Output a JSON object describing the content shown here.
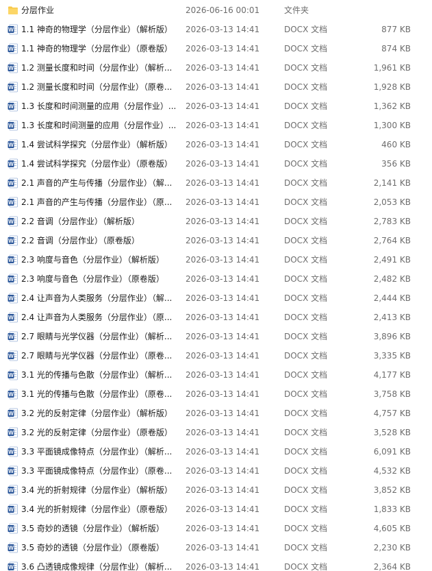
{
  "colors": {
    "word_icon_blue": "#2b579a",
    "folder_yellow": "#f8c94a",
    "secondary_text": "#6d6d6d"
  },
  "rows": [
    {
      "icon": "folder-icon",
      "name": "分层作业",
      "date": "2026-06-16 00:01",
      "type": "文件夹",
      "size": ""
    },
    {
      "icon": "word-doc-icon",
      "name": "1.1 神奇的物理学（分层作业）（解析版）",
      "date": "2026-03-13 14:41",
      "type": "DOCX 文档",
      "size": "877 KB"
    },
    {
      "icon": "word-doc-icon",
      "name": "1.1 神奇的物理学（分层作业）（原卷版）",
      "date": "2026-03-13 14:41",
      "type": "DOCX 文档",
      "size": "874 KB"
    },
    {
      "icon": "word-doc-icon",
      "name": "1.2 测量长度和时间（分层作业）（解析...",
      "date": "2026-03-13 14:41",
      "type": "DOCX 文档",
      "size": "1,961 KB"
    },
    {
      "icon": "word-doc-icon",
      "name": "1.2 测量长度和时间（分层作业）（原卷...",
      "date": "2026-03-13 14:41",
      "type": "DOCX 文档",
      "size": "1,928 KB"
    },
    {
      "icon": "word-doc-icon",
      "name": "1.3 长度和时间测量的应用（分层作业）...",
      "date": "2026-03-13 14:41",
      "type": "DOCX 文档",
      "size": "1,362 KB"
    },
    {
      "icon": "word-doc-icon",
      "name": "1.3 长度和时间测量的应用（分层作业）...",
      "date": "2026-03-13 14:41",
      "type": "DOCX 文档",
      "size": "1,300 KB"
    },
    {
      "icon": "word-doc-icon",
      "name": "1.4 尝试科学探究（分层作业）（解析版）",
      "date": "2026-03-13 14:41",
      "type": "DOCX 文档",
      "size": "460 KB"
    },
    {
      "icon": "word-doc-icon",
      "name": "1.4 尝试科学探究（分层作业）（原卷版）",
      "date": "2026-03-13 14:41",
      "type": "DOCX 文档",
      "size": "356 KB"
    },
    {
      "icon": "word-doc-icon",
      "name": "2.1 声音的产生与传播（分层作业）（解...",
      "date": "2026-03-13 14:41",
      "type": "DOCX 文档",
      "size": "2,141 KB"
    },
    {
      "icon": "word-doc-icon",
      "name": "2.1 声音的产生与传播（分层作业）（原...",
      "date": "2026-03-13 14:41",
      "type": "DOCX 文档",
      "size": "2,053 KB"
    },
    {
      "icon": "word-doc-icon",
      "name": "2.2 音调（分层作业）（解析版）",
      "date": "2026-03-13 14:41",
      "type": "DOCX 文档",
      "size": "2,783 KB"
    },
    {
      "icon": "word-doc-icon",
      "name": "2.2 音调（分层作业）（原卷版）",
      "date": "2026-03-13 14:41",
      "type": "DOCX 文档",
      "size": "2,764 KB"
    },
    {
      "icon": "word-doc-icon",
      "name": "2.3 响度与音色（分层作业）（解析版）",
      "date": "2026-03-13 14:41",
      "type": "DOCX 文档",
      "size": "2,491 KB"
    },
    {
      "icon": "word-doc-icon",
      "name": "2.3 响度与音色（分层作业）（原卷版）",
      "date": "2026-03-13 14:41",
      "type": "DOCX 文档",
      "size": "2,482 KB"
    },
    {
      "icon": "word-doc-icon",
      "name": "2.4 让声音为人类服务（分层作业）（解...",
      "date": "2026-03-13 14:41",
      "type": "DOCX 文档",
      "size": "2,444 KB"
    },
    {
      "icon": "word-doc-icon",
      "name": "2.4 让声音为人类服务（分层作业）（原...",
      "date": "2026-03-13 14:41",
      "type": "DOCX 文档",
      "size": "2,413 KB"
    },
    {
      "icon": "word-doc-icon",
      "name": "2.7 眼睛与光学仪器（分层作业）（解析...",
      "date": "2026-03-13 14:41",
      "type": "DOCX 文档",
      "size": "3,896 KB"
    },
    {
      "icon": "word-doc-icon",
      "name": "2.7 眼睛与光学仪器（分层作业）（原卷...",
      "date": "2026-03-13 14:41",
      "type": "DOCX 文档",
      "size": "3,335 KB"
    },
    {
      "icon": "word-doc-icon",
      "name": "3.1 光的传播与色散（分层作业）（解析...",
      "date": "2026-03-13 14:41",
      "type": "DOCX 文档",
      "size": "4,177 KB"
    },
    {
      "icon": "word-doc-icon",
      "name": "3.1 光的传播与色散（分层作业）（原卷...",
      "date": "2026-03-13 14:41",
      "type": "DOCX 文档",
      "size": "3,758 KB"
    },
    {
      "icon": "word-doc-icon",
      "name": "3.2 光的反射定律（分层作业）（解析版）",
      "date": "2026-03-13 14:41",
      "type": "DOCX 文档",
      "size": "4,757 KB"
    },
    {
      "icon": "word-doc-icon",
      "name": "3.2 光的反射定律（分层作业）（原卷版）",
      "date": "2026-03-13 14:41",
      "type": "DOCX 文档",
      "size": "3,528 KB"
    },
    {
      "icon": "word-doc-icon",
      "name": "3.3 平面镜成像特点（分层作业）（解析...",
      "date": "2026-03-13 14:41",
      "type": "DOCX 文档",
      "size": "6,091 KB"
    },
    {
      "icon": "word-doc-icon",
      "name": "3.3 平面镜成像特点（分层作业）（原卷...",
      "date": "2026-03-13 14:41",
      "type": "DOCX 文档",
      "size": "4,532 KB"
    },
    {
      "icon": "word-doc-icon",
      "name": "3.4 光的折射规律（分层作业）（解析版）",
      "date": "2026-03-13 14:41",
      "type": "DOCX 文档",
      "size": "3,852 KB"
    },
    {
      "icon": "word-doc-icon",
      "name": "3.4 光的折射规律（分层作业）（原卷版）",
      "date": "2026-03-13 14:41",
      "type": "DOCX 文档",
      "size": "1,833 KB"
    },
    {
      "icon": "word-doc-icon",
      "name": "3.5 奇妙的透镜（分层作业）（解析版）",
      "date": "2026-03-13 14:41",
      "type": "DOCX 文档",
      "size": "4,605 KB"
    },
    {
      "icon": "word-doc-icon",
      "name": "3.5 奇妙的透镜（分层作业）（原卷版）",
      "date": "2026-03-13 14:41",
      "type": "DOCX 文档",
      "size": "2,230 KB"
    },
    {
      "icon": "word-doc-icon",
      "name": "3.6 凸透镜成像规律（分层作业）（解析...",
      "date": "2026-03-13 14:41",
      "type": "DOCX 文档",
      "size": "2,364 KB"
    }
  ]
}
